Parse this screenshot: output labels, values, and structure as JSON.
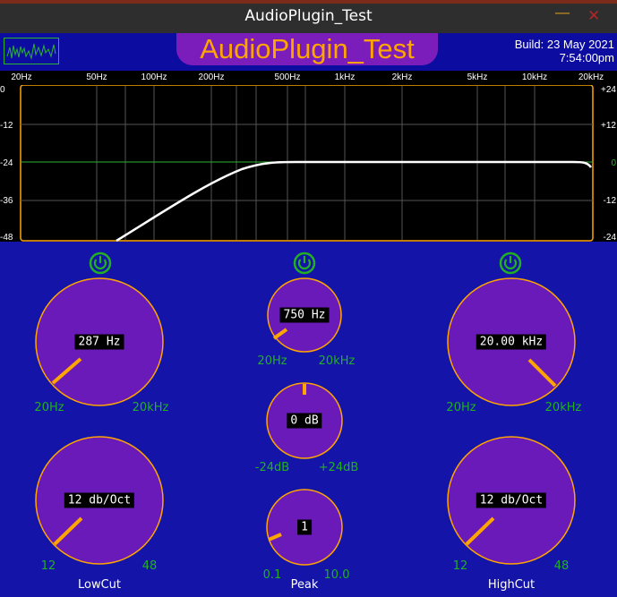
{
  "window": {
    "title": "AudioPlugin_Test"
  },
  "header": {
    "plugin_name": "AudioPlugin_Test",
    "build_line1": "Build: 23 May 2021",
    "build_line2": "7:54:00pm"
  },
  "analyzer": {
    "freq_labels": [
      "20Hz",
      "50Hz",
      "100Hz",
      "200Hz",
      "500Hz",
      "1kHz",
      "2kHz",
      "5kHz",
      "10kHz",
      "20kHz"
    ],
    "left_db_labels": [
      "0",
      "-12",
      "-24",
      "-36",
      "-48"
    ],
    "right_db_labels": [
      "+24",
      "+12",
      "0",
      "-12",
      "-24"
    ]
  },
  "lowcut": {
    "freq_value": "287 Hz",
    "freq_min": "20Hz",
    "freq_max": "20kHz",
    "slope_value": "12 db/Oct",
    "slope_min": "12",
    "slope_max": "48",
    "label": "LowCut"
  },
  "peak": {
    "freq_value": "750 Hz",
    "freq_min": "20Hz",
    "freq_max": "20kHz",
    "gain_value": "0 dB",
    "gain_min": "-24dB",
    "gain_max": "+24dB",
    "q_value": "1",
    "q_min": "0.1",
    "q_max": "10.0",
    "label": "Peak"
  },
  "highcut": {
    "freq_value": "20.00 kHz",
    "freq_min": "20Hz",
    "freq_max": "20kHz",
    "slope_value": "12 db/Oct",
    "slope_min": "12",
    "slope_max": "48",
    "label": "HighCut"
  },
  "colors": {
    "background": "#1414a8",
    "knob_fill": "#6a1ab8",
    "knob_accent": "#ffa500",
    "range_text": "#22b022",
    "power_on": "#22b022"
  }
}
